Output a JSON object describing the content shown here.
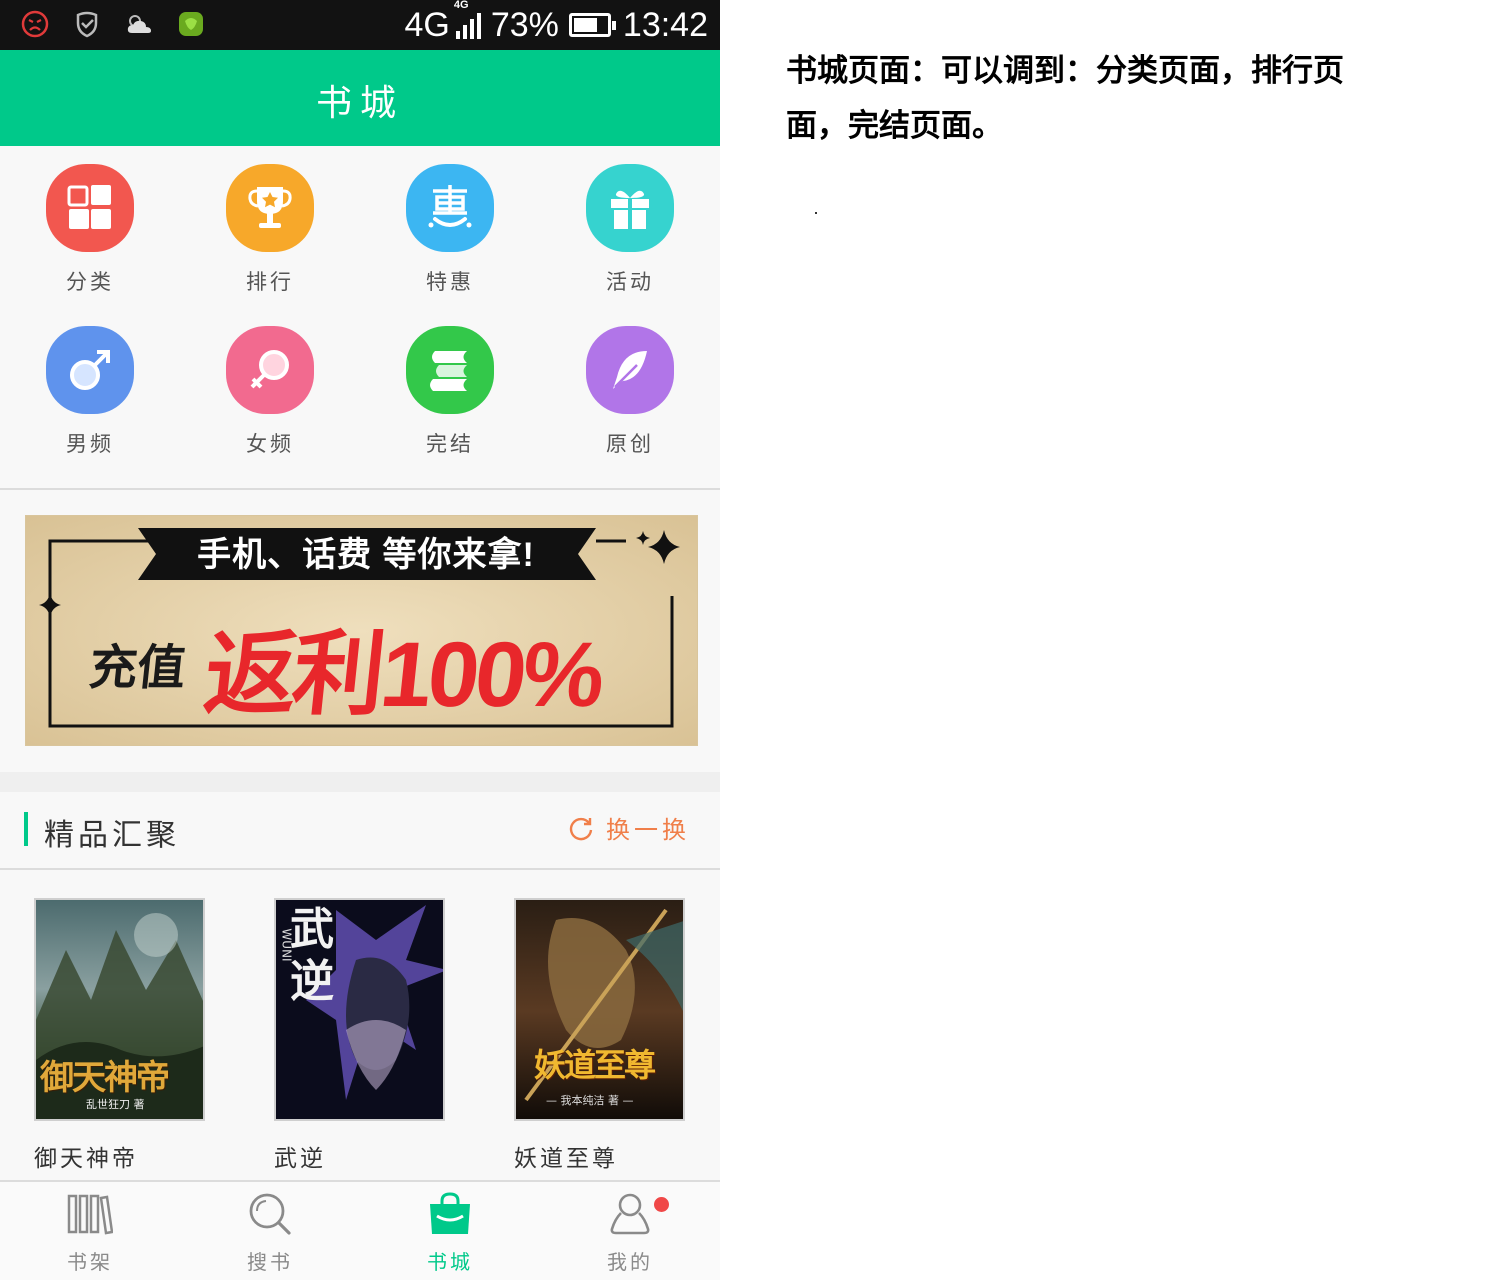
{
  "status_bar": {
    "network": "4G",
    "network_small": "4G",
    "battery": "73%",
    "battery_level": 0.73,
    "time": "13:42",
    "icons": [
      "angry-face-icon",
      "shield-check-icon",
      "cloud-weather-icon",
      "green-app-icon"
    ]
  },
  "app_bar": {
    "title": "书城"
  },
  "categories": [
    {
      "label": "分类",
      "icon": "grid-icon",
      "color": "#f2574f"
    },
    {
      "label": "排行",
      "icon": "trophy-icon",
      "color": "#f7a82a"
    },
    {
      "label": "特惠",
      "icon": "discount-hui-icon",
      "color": "#3cb6f2"
    },
    {
      "label": "活动",
      "icon": "gift-icon",
      "color": "#36d3cf"
    },
    {
      "label": "男频",
      "icon": "male-symbol-icon",
      "color": "#5f93ed"
    },
    {
      "label": "女频",
      "icon": "female-symbol-icon",
      "color": "#f26a8f"
    },
    {
      "label": "完结",
      "icon": "books-stack-icon",
      "color": "#33c84a"
    },
    {
      "label": "原创",
      "icon": "feather-icon",
      "color": "#b175e8"
    }
  ],
  "banner": {
    "top_text": "手机、话费 等你来拿!",
    "left_text": "充值",
    "big_text": "返利100%"
  },
  "section": {
    "title": "精品汇聚",
    "refresh_label": "换一换",
    "accent": "#00c98a",
    "refresh_color": "#f07f4a"
  },
  "books": [
    {
      "title": "御天神帝",
      "cover_text": "御天神帝",
      "cover_author": "乱世狂刀 著"
    },
    {
      "title": "武逆",
      "cover_text": "武逆",
      "cover_author": "WUNI"
    },
    {
      "title": "妖道至尊",
      "cover_text": "妖道至尊",
      "cover_author": "— 我本纯洁 著 —"
    }
  ],
  "tabs": [
    {
      "label": "书架",
      "icon": "bookshelf-icon"
    },
    {
      "label": "搜书",
      "icon": "search-icon"
    },
    {
      "label": "书城",
      "icon": "shopping-bag-icon",
      "active": true
    },
    {
      "label": "我的",
      "icon": "user-icon"
    }
  ],
  "annotation": {
    "text": "书城页面：可以调到：分类页面，排行页面，完结页面。"
  },
  "colors": {
    "brand": "#00c98a",
    "status_bar": "#121212",
    "badge": "#f04848"
  }
}
